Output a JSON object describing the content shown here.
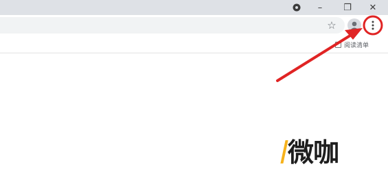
{
  "window_controls": {
    "extension_icon": "record-icon",
    "minimize": "–",
    "restore": "❐",
    "close": "✕"
  },
  "toolbar": {
    "bookmark_icon": "☆",
    "menu_icon": "⋮"
  },
  "bookmarks_bar": {
    "reading_list_label": "阅读清单"
  },
  "annotation": {
    "color": "#e02424"
  },
  "watermark": {
    "text": "微咖"
  }
}
